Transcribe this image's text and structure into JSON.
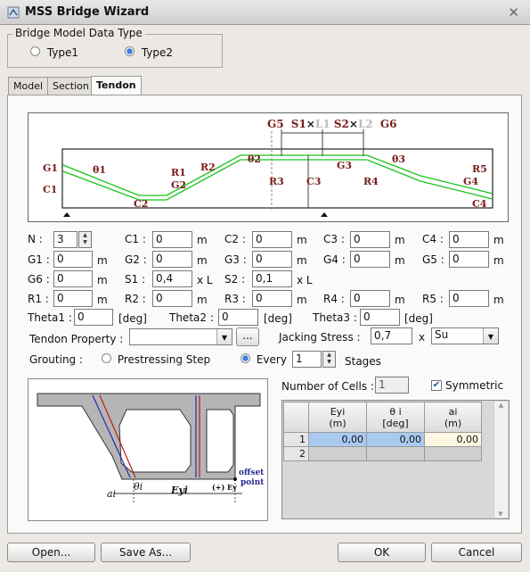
{
  "window": {
    "title": "MSS Bridge Wizard",
    "close_glyph": "✕"
  },
  "model_type": {
    "group_label": "Bridge Model Data Type",
    "options": [
      {
        "label": "Type1",
        "selected": false
      },
      {
        "label": "Type2",
        "selected": true
      }
    ]
  },
  "tabs": [
    {
      "label": "Model"
    },
    {
      "label": "Section"
    },
    {
      "label": "Tendon",
      "active": true
    }
  ],
  "diagram": {
    "top_labels": {
      "g5": "G5",
      "s1": "S1",
      "times1": "×",
      "l1": "L1",
      "s2": "S2",
      "times2": "×",
      "l2": "L2",
      "g6": "G6"
    },
    "labels": {
      "g1": "G1",
      "theta1": "θ1",
      "c1": "C1",
      "r1": "R1",
      "r2": "R2",
      "g2": "G2",
      "c2": "C2",
      "theta2": "θ2",
      "r3": "R3",
      "c3": "C3",
      "g3": "G3",
      "r4": "R4",
      "theta3": "θ3",
      "r5": "R5",
      "g4": "G4",
      "c4": "C4"
    }
  },
  "params": {
    "n": {
      "label": "N :",
      "value": "3"
    },
    "rows": [
      [
        {
          "label": "C1 :",
          "value": "0",
          "unit": "m"
        },
        {
          "label": "C2 :",
          "value": "0",
          "unit": "m"
        },
        {
          "label": "C3 :",
          "value": "0",
          "unit": "m"
        },
        {
          "label": "C4 :",
          "value": "0",
          "unit": "m"
        }
      ],
      [
        {
          "label": "G1 :",
          "value": "0",
          "unit": "m"
        },
        {
          "label": "G2 :",
          "value": "0",
          "unit": "m"
        },
        {
          "label": "G3 :",
          "value": "0",
          "unit": "m"
        },
        {
          "label": "G4 :",
          "value": "0",
          "unit": "m"
        },
        {
          "label": "G5 :",
          "value": "0",
          "unit": "m"
        }
      ],
      [
        {
          "label": "G6 :",
          "value": "0",
          "unit": "m"
        },
        {
          "label": "S1 :",
          "value": "0,4",
          "unit": "x L"
        },
        {
          "label": "S2 :",
          "value": "0,1",
          "unit": "x L"
        }
      ],
      [
        {
          "label": "R1 :",
          "value": "0",
          "unit": "m"
        },
        {
          "label": "R2 :",
          "value": "0",
          "unit": "m"
        },
        {
          "label": "R3 :",
          "value": "0",
          "unit": "m"
        },
        {
          "label": "R4 :",
          "value": "0",
          "unit": "m"
        },
        {
          "label": "R5 :",
          "value": "0",
          "unit": "m"
        }
      ]
    ],
    "thetas": [
      {
        "label": "Theta1 :",
        "value": "0",
        "unit": "[deg]"
      },
      {
        "label": "Theta2 :",
        "value": "0",
        "unit": "[deg]"
      },
      {
        "label": "Theta3 :",
        "value": "0",
        "unit": "[deg]"
      }
    ]
  },
  "tendon": {
    "property_label": "Tendon Property :",
    "property_value": "",
    "browse_label": "...",
    "jacking_label": "Jacking Stress :",
    "jacking_value": "0,7",
    "times": "x",
    "jacking_unit": "Su"
  },
  "grouting": {
    "label": "Grouting :",
    "option1": "Prestressing Step",
    "option2": "Every",
    "every_value": "1",
    "stages_label": "Stages"
  },
  "cells": {
    "label": "Number of Cells :",
    "value": "1",
    "symmetric_label": "Symmetric",
    "symmetric_checked": true
  },
  "grid": {
    "headers": [
      [
        "Eyi",
        "(m)"
      ],
      [
        "θ i",
        "[deg]"
      ],
      [
        "ai",
        "(m)"
      ]
    ],
    "rows": [
      {
        "num": "1",
        "cells": [
          "0,00",
          "0,00",
          "0,00"
        ]
      },
      {
        "num": "2",
        "cells": [
          "",
          "",
          ""
        ]
      }
    ]
  },
  "section_fig": {
    "a_label": "ai",
    "theta_label": "θi",
    "ey_label": "Eyi",
    "plus_ey": "(+) Ey",
    "offset_label": "offset",
    "point_label": "point"
  },
  "buttons": {
    "open": "Open...",
    "save_as": "Save As...",
    "ok": "OK",
    "cancel": "Cancel"
  },
  "colors": {
    "tendon_green": "#19c219",
    "dim_red": "#b0242a",
    "selected_cell": "#a9c9ef",
    "edit_cell": "#fdf6e0"
  }
}
